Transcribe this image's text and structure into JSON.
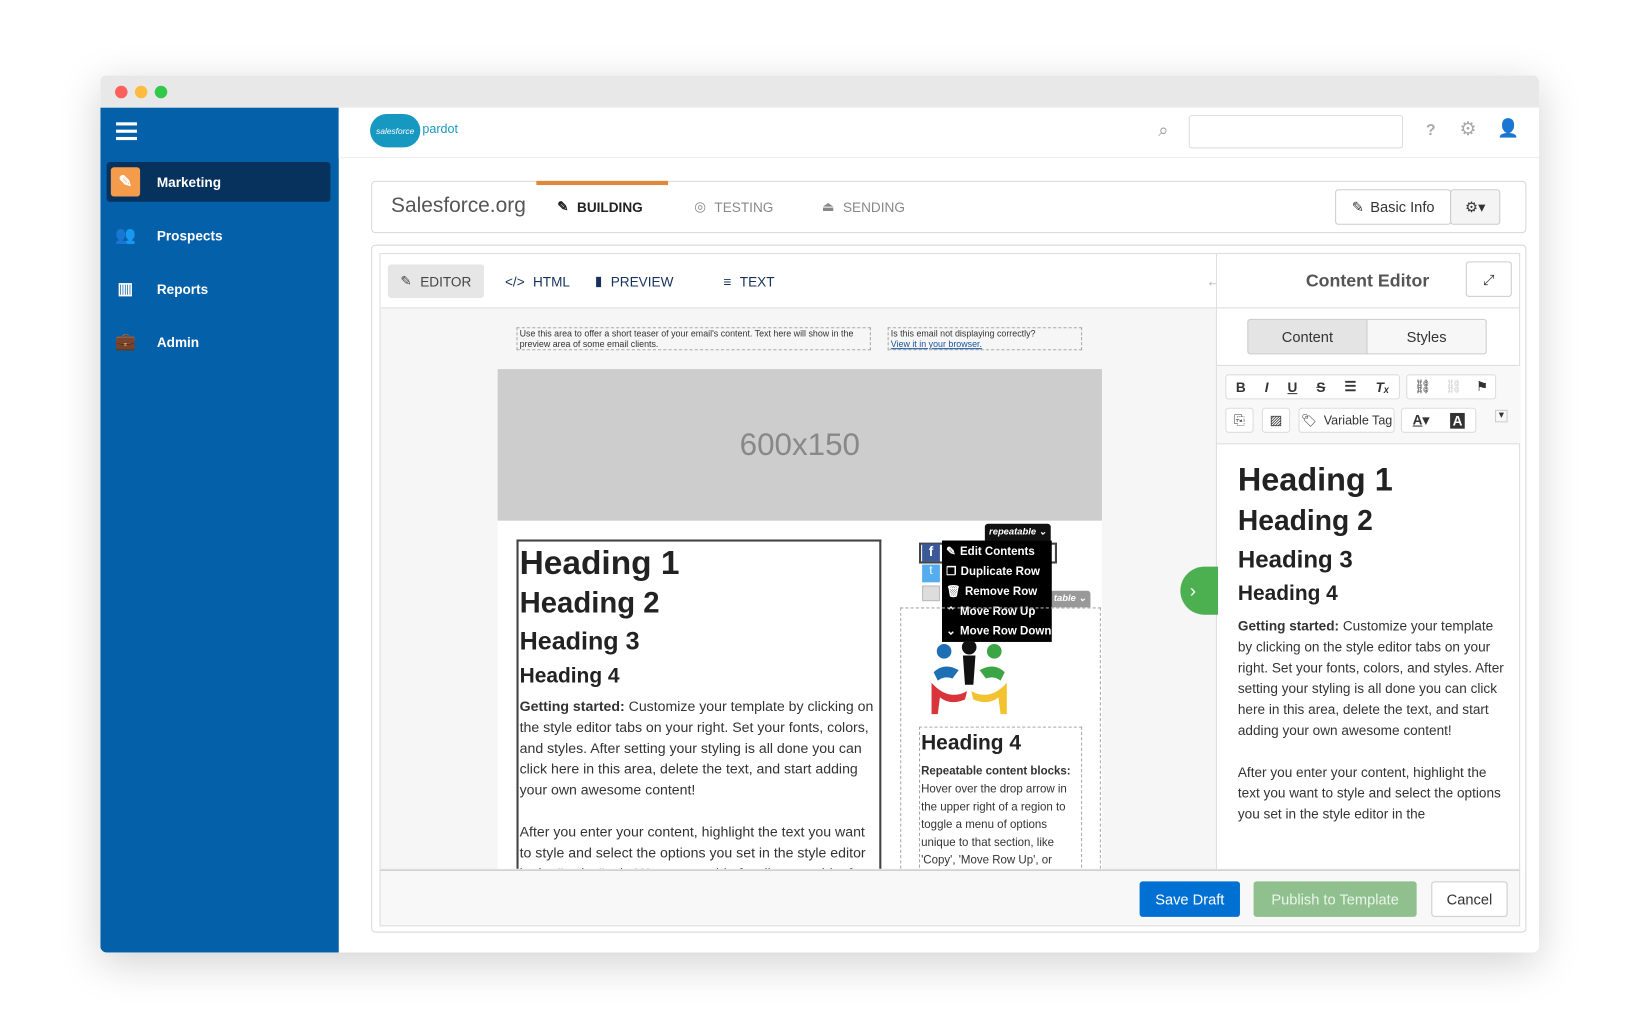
{
  "window": {
    "controls": [
      "close",
      "minimize",
      "maximize"
    ]
  },
  "sidebar": {
    "items": [
      {
        "label": "Marketing",
        "icon": "magic-wand-icon",
        "active": true
      },
      {
        "label": "Prospects",
        "icon": "users-icon"
      },
      {
        "label": "Reports",
        "icon": "bar-chart-icon"
      },
      {
        "label": "Admin",
        "icon": "briefcase-icon"
      }
    ]
  },
  "topbar": {
    "logo_text": "salesforce",
    "product": "pardot",
    "search_placeholder": ""
  },
  "header": {
    "org": "Salesforce.org",
    "steps": [
      {
        "label": "BUILDING",
        "active": true
      },
      {
        "label": "TESTING"
      },
      {
        "label": "SENDING"
      }
    ],
    "basic_info": "Basic Info"
  },
  "editor": {
    "tabs": [
      "EDITOR",
      "HTML",
      "PREVIEW",
      "TEXT"
    ],
    "active_tab": "EDITOR"
  },
  "email": {
    "preheader": "Use this area to offer a short teaser of your email's content. Text here will show in the preview area of some email clients.",
    "browser_q": "Is this email not displaying correctly?",
    "browser_link": "View it in your browser.",
    "banner": "600x150",
    "headings": [
      "Heading 1",
      "Heading 2",
      "Heading 3",
      "Heading 4"
    ],
    "intro_bold": "Getting started:",
    "intro": " Customize your template by clicking on the style editor tabs on your right. Set your fonts, colors, and styles. After setting your styling is all done you can click here in this area, delete the text, and start adding your own awesome content!",
    "para2": "After you enter your content, highlight the text you want to style and select the options you set in the style editor in the \"styles\" tab. Want to get rid of styling on a bit of text",
    "repeatable": "repeatable",
    "menu": [
      "Edit Contents",
      "Duplicate Row",
      "Remove Row",
      "Move Row Up",
      "Move Row Down"
    ],
    "side_heading": "Heading 4",
    "side_bold": "Repeatable content blocks:",
    "side_text": "Hover over the drop arrow in the upper right of a region to toggle a menu of options unique to that section, like 'Copy', 'Move Row Up', or"
  },
  "content_editor": {
    "title": "Content Editor",
    "tabs": [
      "Content",
      "Styles"
    ],
    "active_tab": "Content",
    "variable_tag": "Variable Tag",
    "headings": [
      "Heading 1",
      "Heading 2",
      "Heading 3",
      "Heading 4"
    ],
    "intro_bold": "Getting started:",
    "intro": " Customize your template by clicking on the style editor tabs on your right. Set your fonts, colors, and styles. After setting your styling is all done you can click here in this area, delete the text, and start adding your own awesome content!",
    "para2": "After you enter your content, highlight the text you want to style and select the options you set in the style editor in the"
  },
  "footer": {
    "save": "Save Draft",
    "publish": "Publish to Template",
    "cancel": "Cancel"
  },
  "colors": {
    "sidebar": "#0460a9",
    "accent": "#e0883a",
    "save": "#0070d2",
    "publish": "#8fc08e"
  }
}
